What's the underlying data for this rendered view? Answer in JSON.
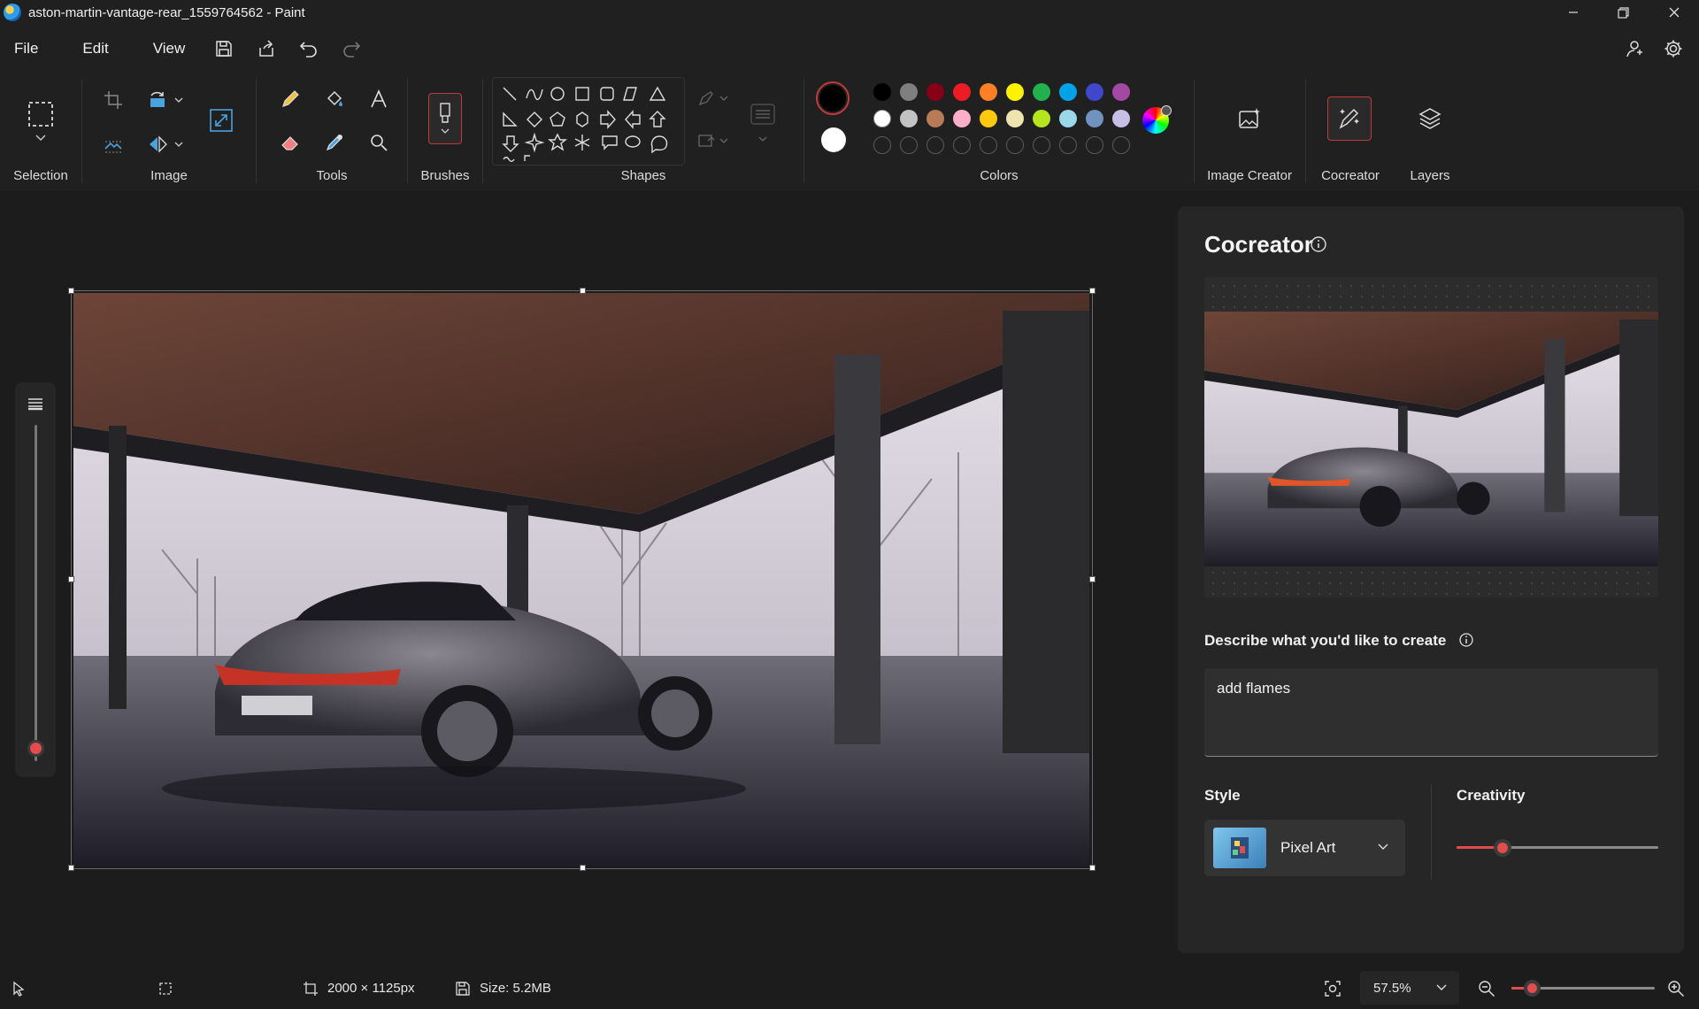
{
  "window": {
    "title": "aston-martin-vantage-rear_1559764562 - Paint"
  },
  "menu": {
    "file": "File",
    "edit": "Edit",
    "view": "View"
  },
  "ribbon": {
    "selection_label": "Selection",
    "image_label": "Image",
    "tools_label": "Tools",
    "brushes_label": "Brushes",
    "shapes_label": "Shapes",
    "colors_label": "Colors",
    "image_creator_label": "Image Creator",
    "cocreator_label": "Cocreator",
    "layers_label": "Layers"
  },
  "colors": {
    "primary": "#000000",
    "secondary": "#ffffff",
    "row1": [
      "#000000",
      "#7f7f7f",
      "#880015",
      "#ed1c24",
      "#ff7f27",
      "#fff200",
      "#22b14c",
      "#00a2e8",
      "#3f48cc",
      "#a349a4"
    ],
    "row2": [
      "#ffffff",
      "#c3c3c3",
      "#b97a57",
      "#ffaec9",
      "#ffc90e",
      "#efe4b0",
      "#b5e61d",
      "#99d9ea",
      "#7092be",
      "#c8bfe7"
    ]
  },
  "cocreator": {
    "title": "Cocreator",
    "describe_label": "Describe what you'd like to create",
    "prompt_value": "add flames",
    "style_label": "Style",
    "style_value": "Pixel Art",
    "creativity_label": "Creativity",
    "creativity_level": 0.2
  },
  "status": {
    "dimensions": "2000 × 1125px",
    "size": "Size: 5.2MB",
    "zoom": "57.5%",
    "zoom_slider_level": 0.1
  },
  "brush_size_level": 0.0
}
